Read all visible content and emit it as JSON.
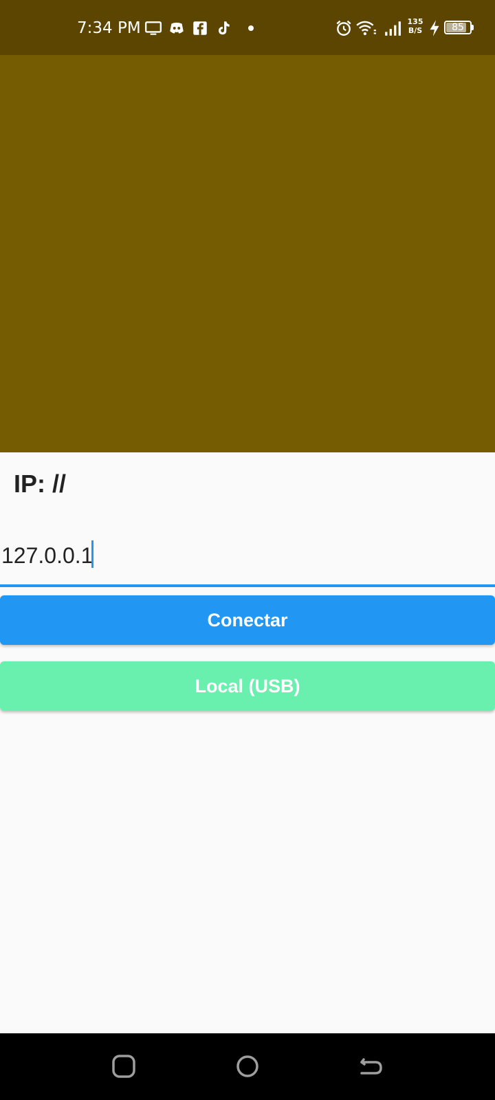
{
  "status_bar": {
    "time": "7:34 PM",
    "net_speed_value": "135",
    "net_speed_unit": "B/S",
    "battery_level": "85",
    "icons": [
      "screen-cast-icon",
      "discord-icon",
      "facebook-icon",
      "tiktok-icon",
      "notification-dot-icon",
      "alarm-icon",
      "wifi-icon",
      "signal-icon",
      "charging-icon",
      "battery-icon"
    ]
  },
  "main": {
    "video_panel_color": "#755b01",
    "ip_label": "IP: //",
    "ip_input_value": "127.0.0.1",
    "connect_button_label": "Conectar",
    "local_button_label": "Local (USB)"
  },
  "colors": {
    "status_bar": "#5b4501",
    "primary": "#2196f3",
    "secondary": "#69f0ae",
    "background": "#fafafa"
  },
  "nav_bar": {
    "buttons": [
      "recents-icon",
      "home-icon",
      "back-icon"
    ]
  }
}
